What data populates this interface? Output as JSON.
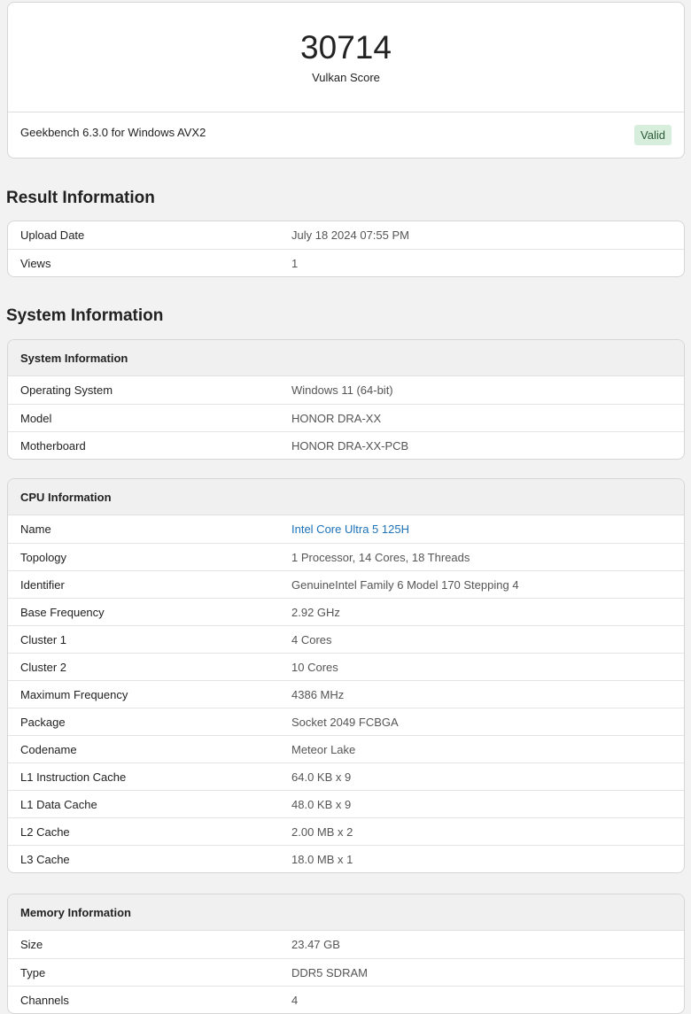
{
  "score": {
    "value": "30714",
    "label": "Vulkan Score",
    "version": "Geekbench 6.3.0 for Windows AVX2",
    "status": "Valid",
    "status_color": "#d8eedc"
  },
  "result_info": {
    "heading": "Result Information",
    "rows": [
      {
        "key": "Upload Date",
        "value": "July 18 2024 07:55 PM"
      },
      {
        "key": "Views",
        "value": "1"
      }
    ]
  },
  "system_section": {
    "heading": "System Information"
  },
  "system_info": {
    "title": "System Information",
    "rows": [
      {
        "key": "Operating System",
        "value": "Windows 11 (64-bit)"
      },
      {
        "key": "Model",
        "value": "HONOR DRA-XX"
      },
      {
        "key": "Motherboard",
        "value": "HONOR DRA-XX-PCB"
      }
    ]
  },
  "cpu_info": {
    "title": "CPU Information",
    "link_color": "#1d72b8",
    "rows": [
      {
        "key": "Name",
        "value": "Intel Core Ultra 5 125H"
      },
      {
        "key": "Topology",
        "value": "1 Processor, 14 Cores, 18 Threads"
      },
      {
        "key": "Identifier",
        "value": "GenuineIntel Family 6 Model 170 Stepping 4"
      },
      {
        "key": "Base Frequency",
        "value": "2.92 GHz"
      },
      {
        "key": "Cluster 1",
        "value": "4 Cores"
      },
      {
        "key": "Cluster 2",
        "value": "10 Cores"
      },
      {
        "key": "Maximum Frequency",
        "value": "4386 MHz"
      },
      {
        "key": "Package",
        "value": "Socket 2049 FCBGA"
      },
      {
        "key": "Codename",
        "value": "Meteor Lake"
      },
      {
        "key": "L1 Instruction Cache",
        "value": "64.0 KB x 9"
      },
      {
        "key": "L1 Data Cache",
        "value": "48.0 KB x 9"
      },
      {
        "key": "L2 Cache",
        "value": "2.00 MB x 2"
      },
      {
        "key": "L3 Cache",
        "value": "18.0 MB x 1"
      }
    ]
  },
  "memory_info": {
    "title": "Memory Information",
    "rows": [
      {
        "key": "Size",
        "value": "23.47 GB"
      },
      {
        "key": "Type",
        "value": "DDR5 SDRAM"
      },
      {
        "key": "Channels",
        "value": "4"
      }
    ]
  }
}
